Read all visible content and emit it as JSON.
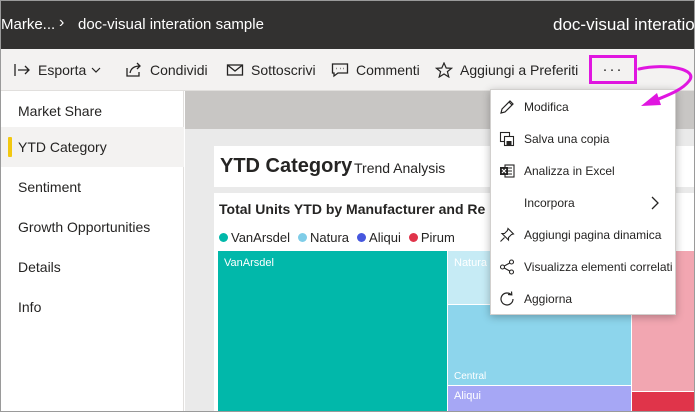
{
  "header": {
    "breadcrumb_workspace": "Marke...",
    "breadcrumb_report": "doc-visual interation sample",
    "report_title": "doc-visual interation"
  },
  "actions": {
    "export": "Esporta",
    "share": "Condividi",
    "subscribe": "Sottoscrivi",
    "comments": "Commenti",
    "favorites": "Aggiungi a Preferiti",
    "more": "···"
  },
  "sidebar": {
    "items": [
      {
        "label": "Market Share",
        "active": false
      },
      {
        "label": "YTD Category",
        "active": true
      },
      {
        "label": "Sentiment",
        "active": false
      },
      {
        "label": "Growth Opportunities",
        "active": false
      },
      {
        "label": "Details",
        "active": false
      },
      {
        "label": "Info",
        "active": false
      }
    ]
  },
  "report": {
    "title": "YTD Category",
    "subtitle": "Trend Analysis",
    "visual_title": "Total Units YTD by Manufacturer and Re",
    "legend": [
      {
        "label": "VanArsdel",
        "color": "#01b8aa"
      },
      {
        "label": "Natura",
        "color": "#7fcde8"
      },
      {
        "label": "Aliqui",
        "color": "#4657de"
      },
      {
        "label": "Pirum",
        "color": "#e0344a"
      }
    ],
    "treemap_labels": {
      "vanarsdel": "VanArsdel",
      "natura": "Natura",
      "central": "Central",
      "aliqui": "Aliqui"
    }
  },
  "menu": {
    "items": [
      {
        "label": "Modifica",
        "icon": "pencil-icon"
      },
      {
        "label": "Salva una copia",
        "icon": "save-copy-icon"
      },
      {
        "label": "Analizza in Excel",
        "icon": "excel-icon"
      },
      {
        "label": "Incorpora",
        "icon": "",
        "has_submenu": true
      },
      {
        "label": "Aggiungi pagina dinamica",
        "icon": "pin-icon"
      },
      {
        "label": "Visualizza elementi correlati",
        "icon": "related-icon"
      },
      {
        "label": "Aggiorna",
        "icon": "refresh-icon"
      }
    ]
  },
  "colors": {
    "highlight": "#e016e0",
    "active_marker": "#f2c811"
  }
}
